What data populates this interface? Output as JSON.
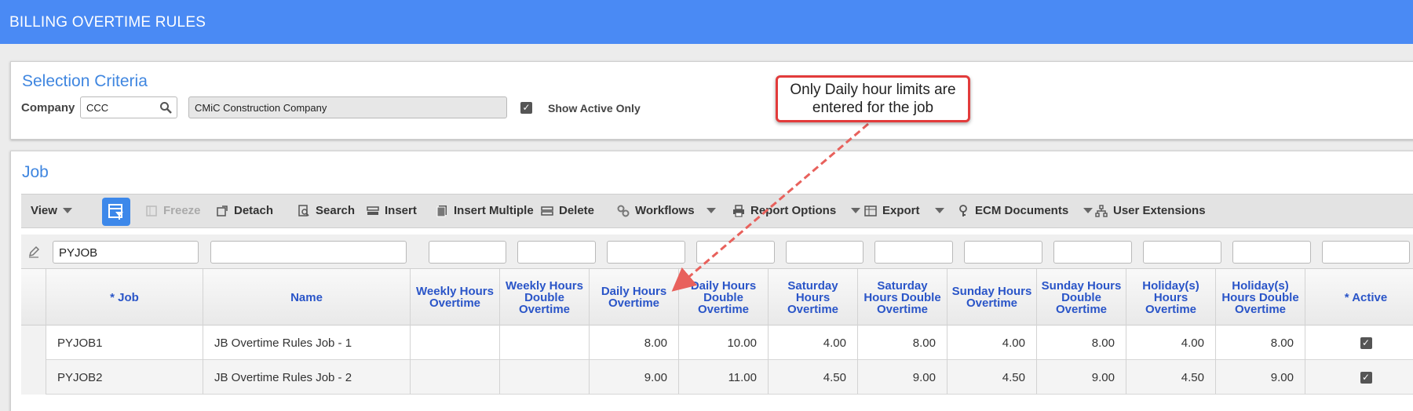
{
  "window": {
    "title": "BILLING OVERTIME RULES"
  },
  "selection": {
    "title": "Selection Criteria",
    "company_label": "Company",
    "company_value": "CCC",
    "company_name": "CMiC Construction Company",
    "show_active_only_label": "Show Active Only",
    "show_active_only_checked": true
  },
  "job": {
    "title": "Job",
    "toolbar": {
      "view": "View",
      "freeze": "Freeze",
      "detach": "Detach",
      "search": "Search",
      "insert": "Insert",
      "insert_multiple": "Insert Multiple",
      "delete": "Delete",
      "workflows": "Workflows",
      "report_options": "Report Options",
      "export": "Export",
      "ecm_documents": "ECM Documents",
      "user_extensions": "User Extensions"
    },
    "filter": {
      "job": "PYJOB"
    },
    "columns": [
      "* Job",
      "Name",
      "Weekly Hours Overtime",
      "Weekly Hours Double Overtime",
      "Daily Hours Overtime",
      "Daily Hours Double Overtime",
      "Saturday Hours Overtime",
      "Saturday Hours Double Overtime",
      "Sunday Hours Overtime",
      "Sunday Hours Double Overtime",
      "Holiday(s) Hours Overtime",
      "Holiday(s) Hours Double Overtime",
      "* Active"
    ],
    "rows": [
      {
        "job": "PYJOB1",
        "name": "JB Overtime Rules Job - 1",
        "weekly_ot": "",
        "weekly_dot": "",
        "daily_ot": "8.00",
        "daily_dot": "10.00",
        "sat_ot": "4.00",
        "sat_dot": "8.00",
        "sun_ot": "4.00",
        "sun_dot": "8.00",
        "hol_ot": "4.00",
        "hol_dot": "8.00",
        "active": true
      },
      {
        "job": "PYJOB2",
        "name": "JB Overtime Rules Job - 2",
        "weekly_ot": "",
        "weekly_dot": "",
        "daily_ot": "9.00",
        "daily_dot": "11.00",
        "sat_ot": "4.50",
        "sat_dot": "9.00",
        "sun_ot": "4.50",
        "sun_dot": "9.00",
        "hol_ot": "4.50",
        "hol_dot": "9.00",
        "active": true
      }
    ]
  },
  "callout": {
    "text": "Only Daily hour limits are entered for the job",
    "border_color": "#e23b3b"
  },
  "colors": {
    "header": "#4a8af4",
    "accent": "#3f86e0",
    "column_header_text": "#2a55c8"
  }
}
